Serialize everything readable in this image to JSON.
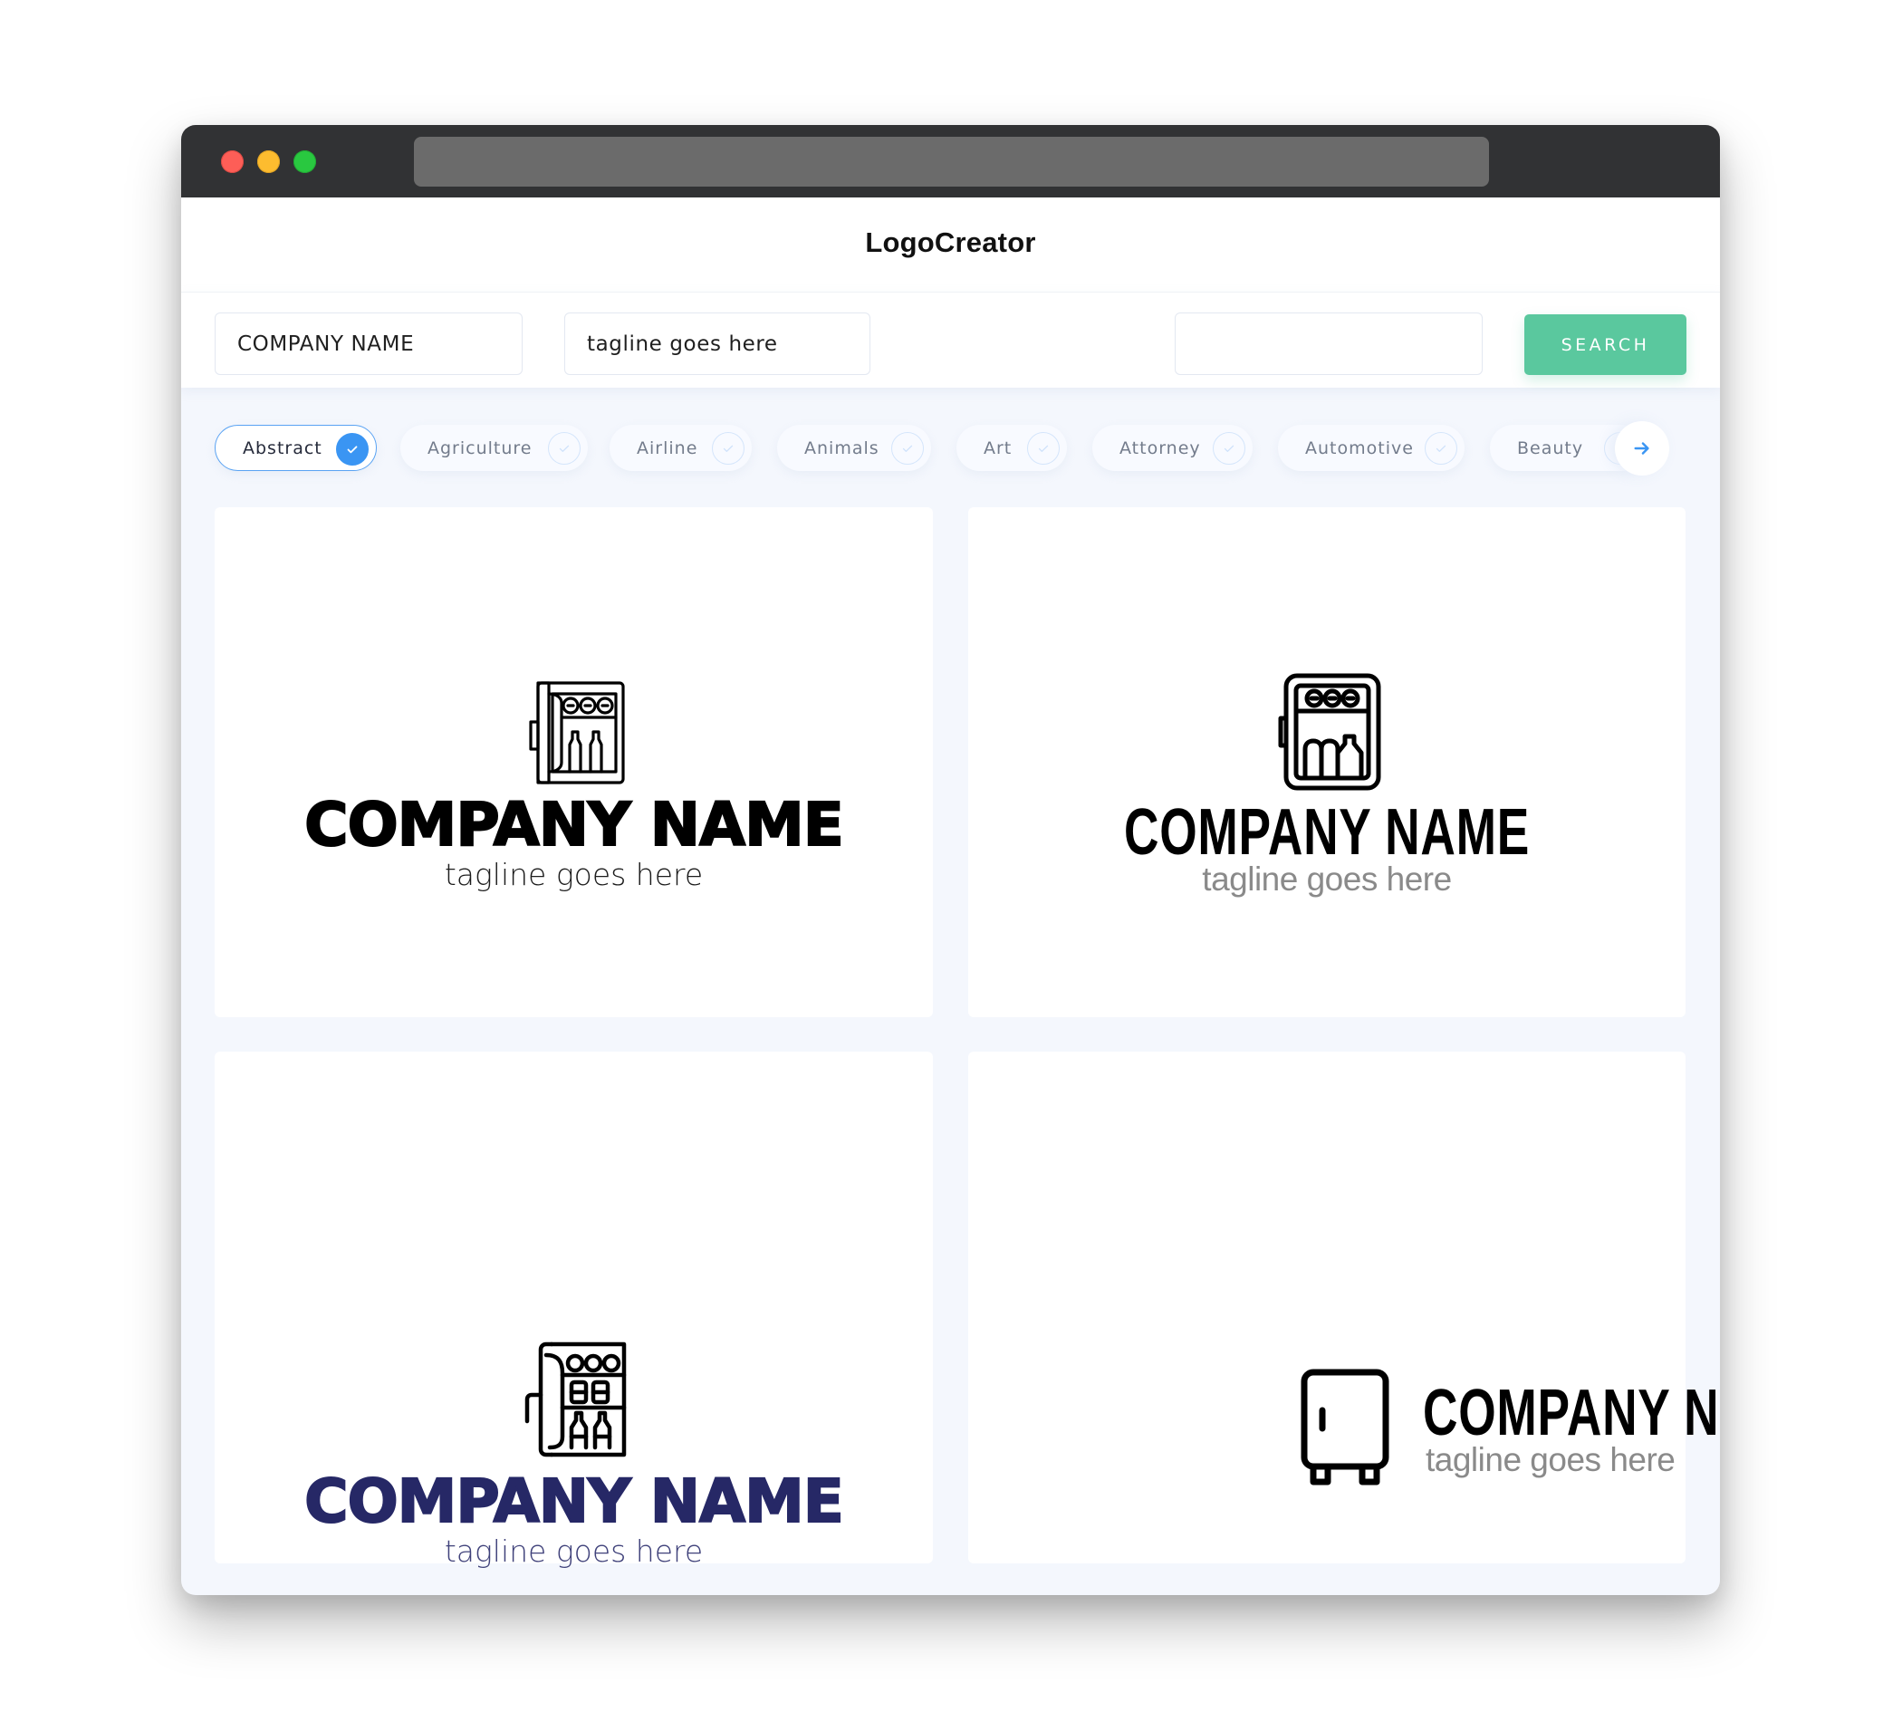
{
  "window": {
    "traffic_lights": [
      "close",
      "minimize",
      "maximize"
    ],
    "colors": {
      "close": "#fd5e57",
      "minimize": "#fdbc2f",
      "maximize": "#29c840"
    }
  },
  "header": {
    "title": "LogoCreator"
  },
  "search": {
    "company_name_value": "COMPANY NAME",
    "tagline_value": "tagline goes here",
    "keyword_value": "",
    "button_label": "SEARCH",
    "button_color": "#5ac89e"
  },
  "categories": {
    "items": [
      {
        "label": "Abstract",
        "selected": true
      },
      {
        "label": "Agriculture",
        "selected": false
      },
      {
        "label": "Airline",
        "selected": false
      },
      {
        "label": "Animals",
        "selected": false
      },
      {
        "label": "Art",
        "selected": false
      },
      {
        "label": "Attorney",
        "selected": false
      },
      {
        "label": "Automotive",
        "selected": false
      },
      {
        "label": "Beauty",
        "selected": false
      }
    ],
    "next_icon": "arrow-right-icon",
    "accent_color": "#3a95f3"
  },
  "logos": [
    {
      "icon": "minibar-fridge-icon",
      "name": "COMPANY NAME",
      "tagline": "tagline goes here",
      "name_color": "#000000",
      "tagline_color": "#1c1c1c"
    },
    {
      "icon": "minibar-fridge-icon",
      "name": "COMPANY NAME",
      "tagline": "tagline goes here",
      "name_color": "#000000",
      "tagline_color": "#8a8a8a"
    },
    {
      "icon": "minibar-fridge-icon",
      "name": "COMPANY NAME",
      "tagline": "tagline goes here",
      "name_color": "#262866",
      "tagline_color": "#3f417a"
    },
    {
      "icon": "fridge-icon",
      "name": "COMPANY NAME",
      "tagline": "tagline goes here",
      "name_color": "#000000",
      "tagline_color": "#8a8a8a"
    }
  ]
}
